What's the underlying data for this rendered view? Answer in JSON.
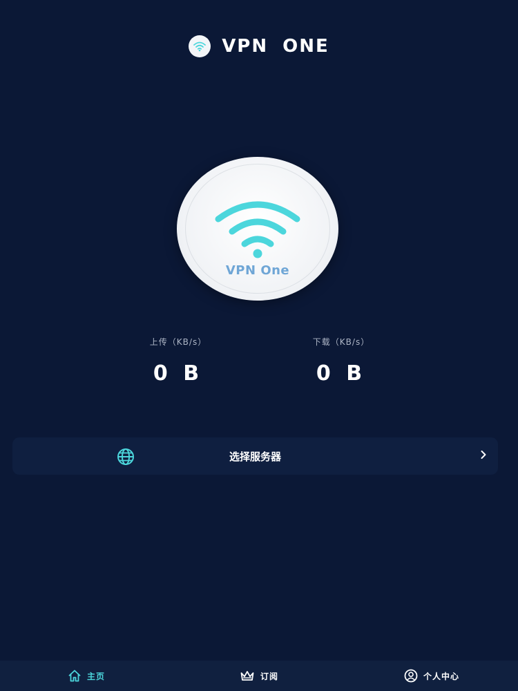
{
  "header": {
    "title": "VPN  ONE",
    "logo_icon": "wifi-icon"
  },
  "connect": {
    "label": "VPN One",
    "icon": "wifi-icon",
    "icon_color": "#4cd6dc"
  },
  "stats": {
    "upload": {
      "label": "上传（KB/s）",
      "value": "0 B"
    },
    "download": {
      "label": "下载（KB/s）",
      "value": "0 B"
    }
  },
  "server": {
    "icon": "globe-icon",
    "label": "选择服务器",
    "chevron_icon": "chevron-right-icon"
  },
  "tabbar": {
    "items": [
      {
        "label": "主页",
        "icon": "home-icon",
        "active": true
      },
      {
        "label": "订阅",
        "icon": "crown-icon",
        "active": false
      },
      {
        "label": "个人中心",
        "icon": "user-circle-icon",
        "active": false
      }
    ]
  },
  "colors": {
    "background": "#0b1836",
    "accent": "#4cd6dc",
    "card": "#0f1f40",
    "tabbar": "#10203f"
  }
}
